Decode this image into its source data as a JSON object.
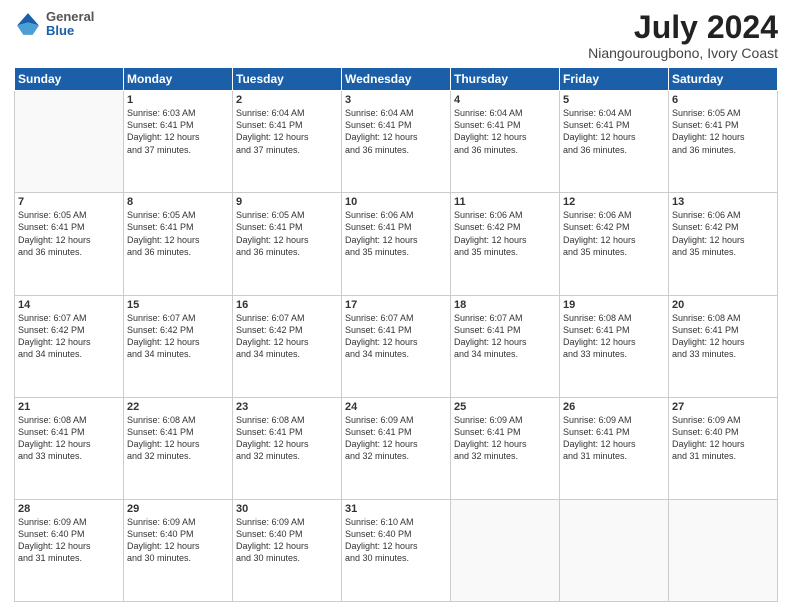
{
  "header": {
    "logo_general": "General",
    "logo_blue": "Blue",
    "title": "July 2024",
    "subtitle": "Niangourougbono, Ivory Coast"
  },
  "weekdays": [
    "Sunday",
    "Monday",
    "Tuesday",
    "Wednesday",
    "Thursday",
    "Friday",
    "Saturday"
  ],
  "weeks": [
    [
      {
        "day": "",
        "info": ""
      },
      {
        "day": "1",
        "info": "Sunrise: 6:03 AM\nSunset: 6:41 PM\nDaylight: 12 hours\nand 37 minutes."
      },
      {
        "day": "2",
        "info": "Sunrise: 6:04 AM\nSunset: 6:41 PM\nDaylight: 12 hours\nand 37 minutes."
      },
      {
        "day": "3",
        "info": "Sunrise: 6:04 AM\nSunset: 6:41 PM\nDaylight: 12 hours\nand 36 minutes."
      },
      {
        "day": "4",
        "info": "Sunrise: 6:04 AM\nSunset: 6:41 PM\nDaylight: 12 hours\nand 36 minutes."
      },
      {
        "day": "5",
        "info": "Sunrise: 6:04 AM\nSunset: 6:41 PM\nDaylight: 12 hours\nand 36 minutes."
      },
      {
        "day": "6",
        "info": "Sunrise: 6:05 AM\nSunset: 6:41 PM\nDaylight: 12 hours\nand 36 minutes."
      }
    ],
    [
      {
        "day": "7",
        "info": "Sunrise: 6:05 AM\nSunset: 6:41 PM\nDaylight: 12 hours\nand 36 minutes."
      },
      {
        "day": "8",
        "info": "Sunrise: 6:05 AM\nSunset: 6:41 PM\nDaylight: 12 hours\nand 36 minutes."
      },
      {
        "day": "9",
        "info": "Sunrise: 6:05 AM\nSunset: 6:41 PM\nDaylight: 12 hours\nand 36 minutes."
      },
      {
        "day": "10",
        "info": "Sunrise: 6:06 AM\nSunset: 6:41 PM\nDaylight: 12 hours\nand 35 minutes."
      },
      {
        "day": "11",
        "info": "Sunrise: 6:06 AM\nSunset: 6:42 PM\nDaylight: 12 hours\nand 35 minutes."
      },
      {
        "day": "12",
        "info": "Sunrise: 6:06 AM\nSunset: 6:42 PM\nDaylight: 12 hours\nand 35 minutes."
      },
      {
        "day": "13",
        "info": "Sunrise: 6:06 AM\nSunset: 6:42 PM\nDaylight: 12 hours\nand 35 minutes."
      }
    ],
    [
      {
        "day": "14",
        "info": "Sunrise: 6:07 AM\nSunset: 6:42 PM\nDaylight: 12 hours\nand 34 minutes."
      },
      {
        "day": "15",
        "info": "Sunrise: 6:07 AM\nSunset: 6:42 PM\nDaylight: 12 hours\nand 34 minutes."
      },
      {
        "day": "16",
        "info": "Sunrise: 6:07 AM\nSunset: 6:42 PM\nDaylight: 12 hours\nand 34 minutes."
      },
      {
        "day": "17",
        "info": "Sunrise: 6:07 AM\nSunset: 6:41 PM\nDaylight: 12 hours\nand 34 minutes."
      },
      {
        "day": "18",
        "info": "Sunrise: 6:07 AM\nSunset: 6:41 PM\nDaylight: 12 hours\nand 34 minutes."
      },
      {
        "day": "19",
        "info": "Sunrise: 6:08 AM\nSunset: 6:41 PM\nDaylight: 12 hours\nand 33 minutes."
      },
      {
        "day": "20",
        "info": "Sunrise: 6:08 AM\nSunset: 6:41 PM\nDaylight: 12 hours\nand 33 minutes."
      }
    ],
    [
      {
        "day": "21",
        "info": "Sunrise: 6:08 AM\nSunset: 6:41 PM\nDaylight: 12 hours\nand 33 minutes."
      },
      {
        "day": "22",
        "info": "Sunrise: 6:08 AM\nSunset: 6:41 PM\nDaylight: 12 hours\nand 32 minutes."
      },
      {
        "day": "23",
        "info": "Sunrise: 6:08 AM\nSunset: 6:41 PM\nDaylight: 12 hours\nand 32 minutes."
      },
      {
        "day": "24",
        "info": "Sunrise: 6:09 AM\nSunset: 6:41 PM\nDaylight: 12 hours\nand 32 minutes."
      },
      {
        "day": "25",
        "info": "Sunrise: 6:09 AM\nSunset: 6:41 PM\nDaylight: 12 hours\nand 32 minutes."
      },
      {
        "day": "26",
        "info": "Sunrise: 6:09 AM\nSunset: 6:41 PM\nDaylight: 12 hours\nand 31 minutes."
      },
      {
        "day": "27",
        "info": "Sunrise: 6:09 AM\nSunset: 6:40 PM\nDaylight: 12 hours\nand 31 minutes."
      }
    ],
    [
      {
        "day": "28",
        "info": "Sunrise: 6:09 AM\nSunset: 6:40 PM\nDaylight: 12 hours\nand 31 minutes."
      },
      {
        "day": "29",
        "info": "Sunrise: 6:09 AM\nSunset: 6:40 PM\nDaylight: 12 hours\nand 30 minutes."
      },
      {
        "day": "30",
        "info": "Sunrise: 6:09 AM\nSunset: 6:40 PM\nDaylight: 12 hours\nand 30 minutes."
      },
      {
        "day": "31",
        "info": "Sunrise: 6:10 AM\nSunset: 6:40 PM\nDaylight: 12 hours\nand 30 minutes."
      },
      {
        "day": "",
        "info": ""
      },
      {
        "day": "",
        "info": ""
      },
      {
        "day": "",
        "info": ""
      }
    ]
  ]
}
